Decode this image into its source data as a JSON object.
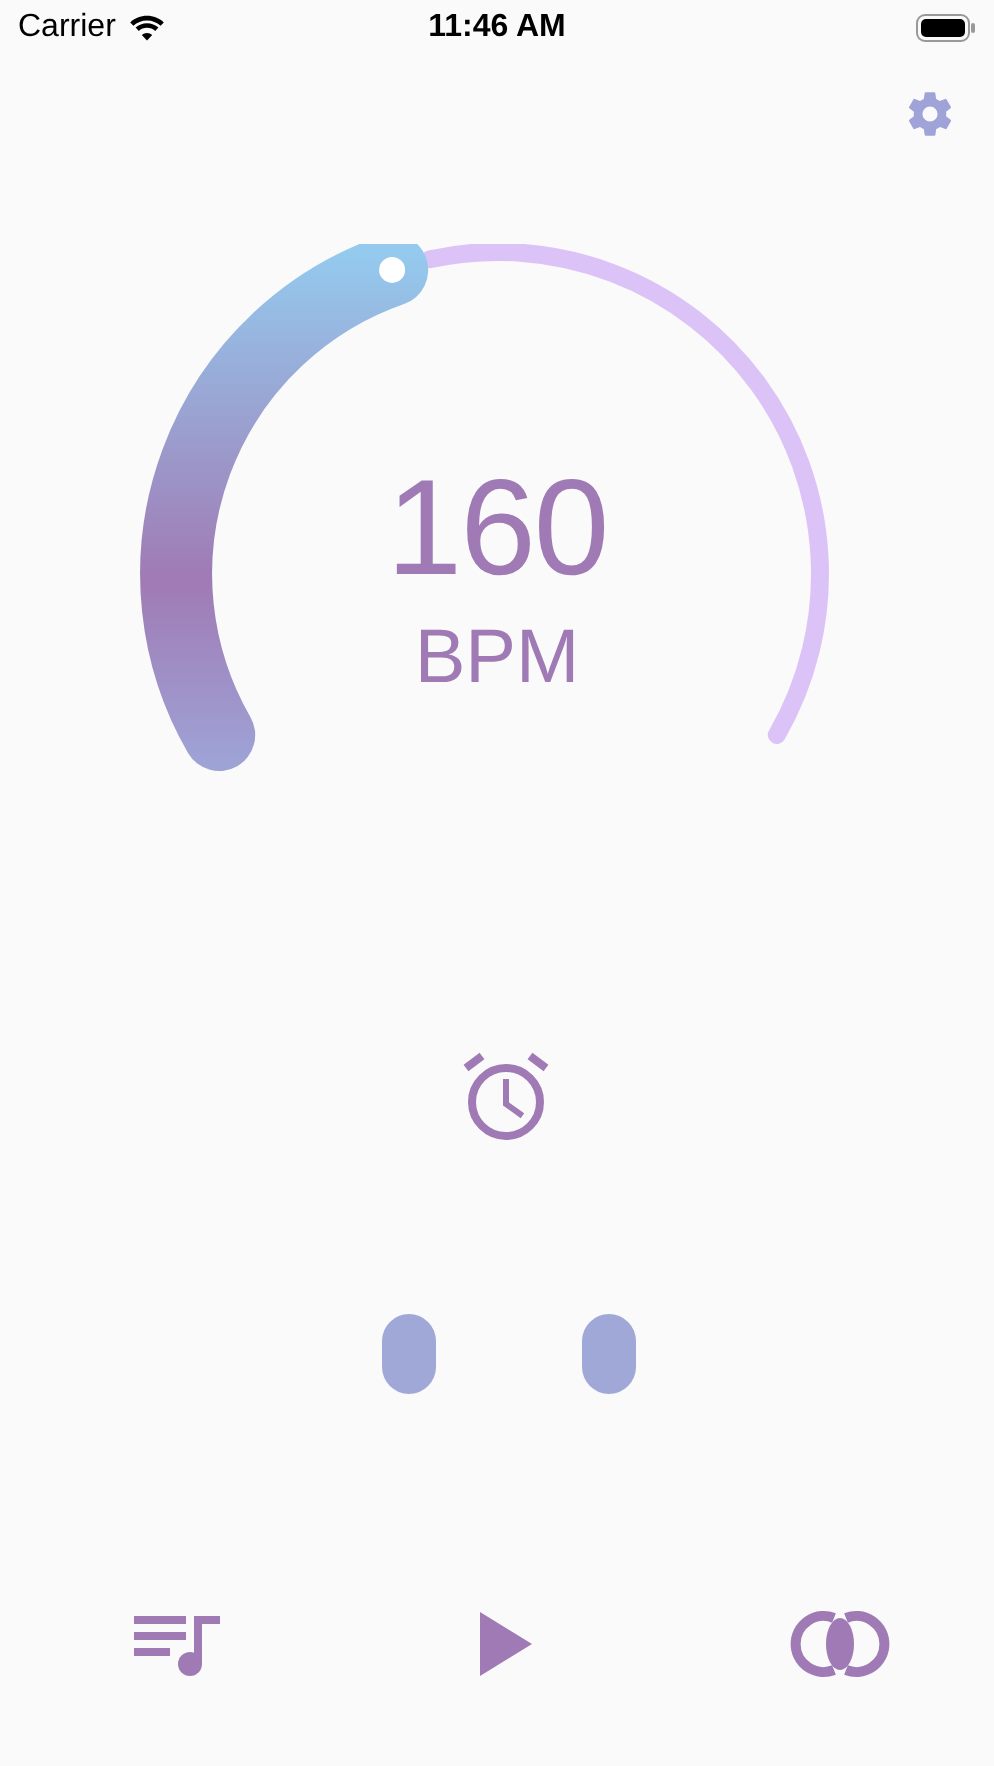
{
  "status_bar": {
    "carrier": "Carrier",
    "time": "11:46 AM"
  },
  "tempo": {
    "value": "160",
    "unit": "BPM"
  }
}
